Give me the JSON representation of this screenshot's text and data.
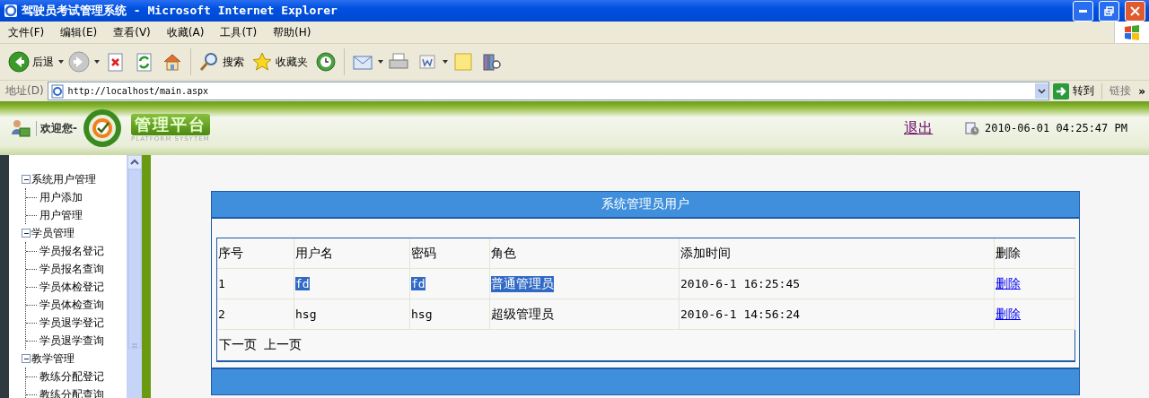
{
  "window": {
    "title": "驾驶员考试管理系统 - Microsoft Internet Explorer"
  },
  "menu": [
    "文件(F)",
    "编辑(E)",
    "查看(V)",
    "收藏(A)",
    "工具(T)",
    "帮助(H)"
  ],
  "toolbar": [
    {
      "kind": "back",
      "label": "后退"
    },
    {
      "kind": "forward"
    },
    {
      "kind": "stop"
    },
    {
      "kind": "refresh"
    },
    {
      "kind": "home"
    },
    {
      "kind": "search",
      "label": "搜索"
    },
    {
      "kind": "favorites",
      "label": "收藏夹"
    },
    {
      "kind": "history"
    },
    {
      "kind": "mail"
    },
    {
      "kind": "print"
    },
    {
      "kind": "edit"
    },
    {
      "kind": "discuss"
    },
    {
      "kind": "research"
    }
  ],
  "address": {
    "label": "地址(D)",
    "url": "http://localhost/main.aspx",
    "go": "转到",
    "links": "链接",
    "more": "»"
  },
  "header": {
    "welcome": "欢迎您-",
    "logo_title": "管理平台",
    "logo_subtitle": "PLATFORM SYSYTEM",
    "logout": "退出",
    "datetime": "2010-06-01 04:25:47 PM"
  },
  "sidebar": {
    "items": [
      {
        "label": "系统用户管理",
        "expanded": true,
        "children": [
          {
            "label": "用户添加"
          },
          {
            "label": "用户管理"
          }
        ]
      },
      {
        "label": "学员管理",
        "expanded": true,
        "children": [
          {
            "label": "学员报名登记"
          },
          {
            "label": "学员报名查询"
          },
          {
            "label": "学员体检登记"
          },
          {
            "label": "学员体检查询"
          },
          {
            "label": "学员退学登记"
          },
          {
            "label": "学员退学查询"
          }
        ]
      },
      {
        "label": "教学管理",
        "expanded": true,
        "children": [
          {
            "label": "教练分配登记"
          },
          {
            "label": "教练分配查询"
          }
        ]
      }
    ]
  },
  "panel": {
    "title": "系统管理员用户",
    "table": {
      "columns": [
        "序号",
        "用户名",
        "密码",
        "角色",
        "添加时间",
        "删除"
      ],
      "rows": [
        {
          "cells": [
            {
              "text": "1",
              "highlighted": false
            },
            {
              "text": "fd",
              "highlighted": true
            },
            {
              "text": "fd",
              "highlighted": true
            },
            {
              "text": "普通管理员",
              "highlighted": true
            },
            {
              "text": "2010-6-1 16:25:45",
              "highlighted": false
            }
          ],
          "delete": "删除"
        },
        {
          "cells": [
            {
              "text": "2",
              "highlighted": false
            },
            {
              "text": "hsg",
              "highlighted": false
            },
            {
              "text": "hsg",
              "highlighted": false
            },
            {
              "text": "超级管理员",
              "highlighted": false
            },
            {
              "text": "2010-6-1 14:56:24",
              "highlighted": false
            }
          ],
          "delete": "删除"
        }
      ]
    },
    "pager": [
      "下一页",
      "上一页"
    ]
  }
}
